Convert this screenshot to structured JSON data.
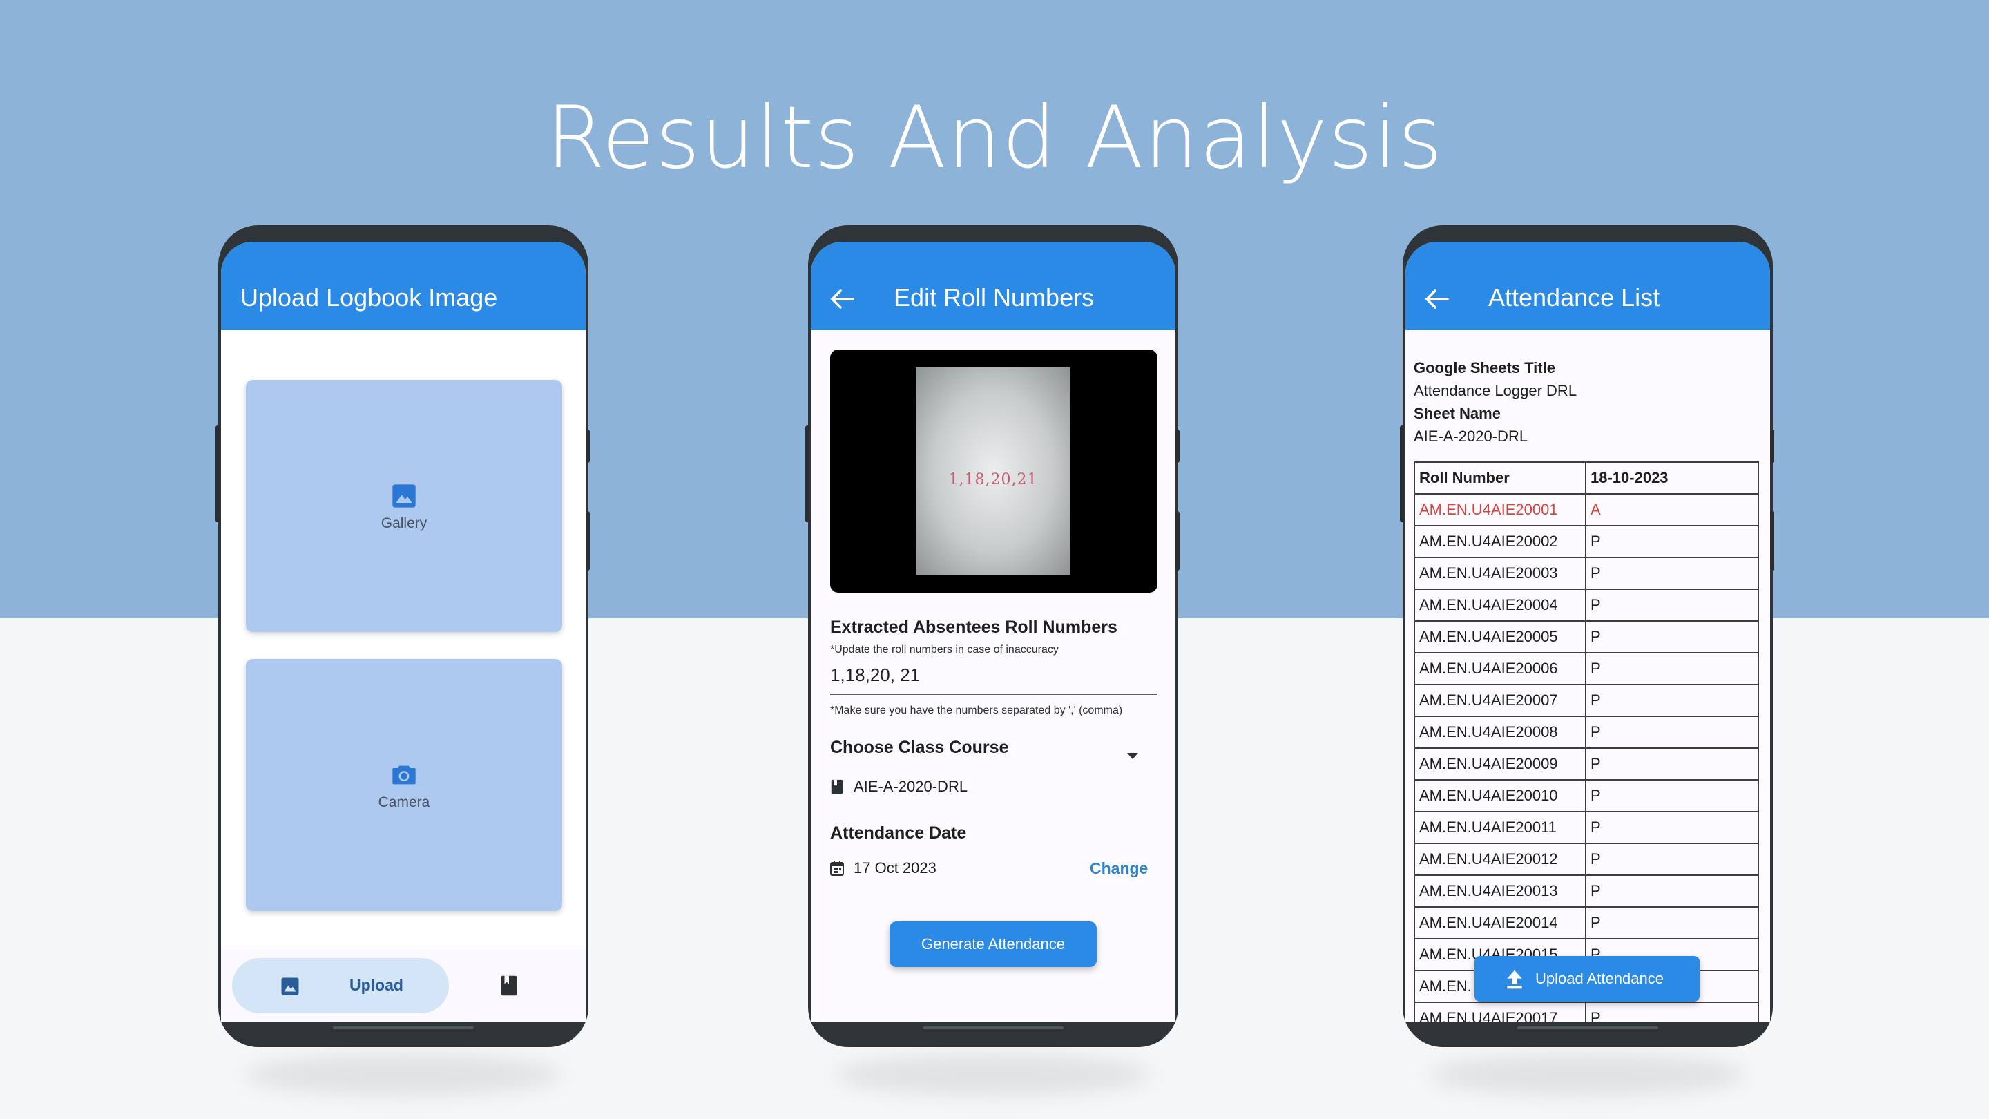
{
  "slide": {
    "title": "Results And Analysis"
  },
  "phone1": {
    "appbar_title": "Upload Logbook Image",
    "tiles": [
      {
        "label": "Gallery",
        "icon": "image-icon"
      },
      {
        "label": "Camera",
        "icon": "camera-icon"
      }
    ],
    "nav": {
      "upload_label": "Upload",
      "upload_icon": "image-icon",
      "second_icon": "book-icon"
    }
  },
  "phone2": {
    "appbar_title": "Edit Roll Numbers",
    "image_text": "1,18,20,21",
    "extracted_heading": "Extracted Absentees Roll Numbers",
    "extracted_note": "*Update the roll numbers in case of inaccuracy",
    "roll_numbers_value": "1,18,20, 21",
    "separator_note": "*Make sure you have the numbers separated by ',' (comma)",
    "course_heading": "Choose Class Course",
    "course_value": "AIE-A-2020-DRL",
    "date_heading": "Attendance Date",
    "date_value": "17 Oct 2023",
    "change_label": "Change",
    "generate_label": "Generate Attendance"
  },
  "phone3": {
    "appbar_title": "Attendance List",
    "sheets_title_label": "Google Sheets Title",
    "sheets_title_value": "Attendance Logger DRL",
    "sheet_name_label": "Sheet Name",
    "sheet_name_value": "AIE-A-2020-DRL",
    "table": {
      "headers": [
        "Roll Number",
        "18-10-2023"
      ],
      "rows": [
        [
          "AM.EN.U4AIE20001",
          "A"
        ],
        [
          "AM.EN.U4AIE20002",
          "P"
        ],
        [
          "AM.EN.U4AIE20003",
          "P"
        ],
        [
          "AM.EN.U4AIE20004",
          "P"
        ],
        [
          "AM.EN.U4AIE20005",
          "P"
        ],
        [
          "AM.EN.U4AIE20006",
          "P"
        ],
        [
          "AM.EN.U4AIE20007",
          "P"
        ],
        [
          "AM.EN.U4AIE20008",
          "P"
        ],
        [
          "AM.EN.U4AIE20009",
          "P"
        ],
        [
          "AM.EN.U4AIE20010",
          "P"
        ],
        [
          "AM.EN.U4AIE20011",
          "P"
        ],
        [
          "AM.EN.U4AIE20012",
          "P"
        ],
        [
          "AM.EN.U4AIE20013",
          "P"
        ],
        [
          "AM.EN.U4AIE20014",
          "P"
        ],
        [
          "AM.EN.U4AIE20015",
          "P"
        ],
        [
          "AM.EN.",
          ""
        ],
        [
          "AM.EN.U4AIE20017",
          "P"
        ]
      ]
    },
    "upload_label": "Upload Attendance"
  },
  "colors": {
    "appbar": "#2b8ae6",
    "background_band": "#8db3d9",
    "absent": "#d9443c",
    "link": "#2a86cf"
  }
}
